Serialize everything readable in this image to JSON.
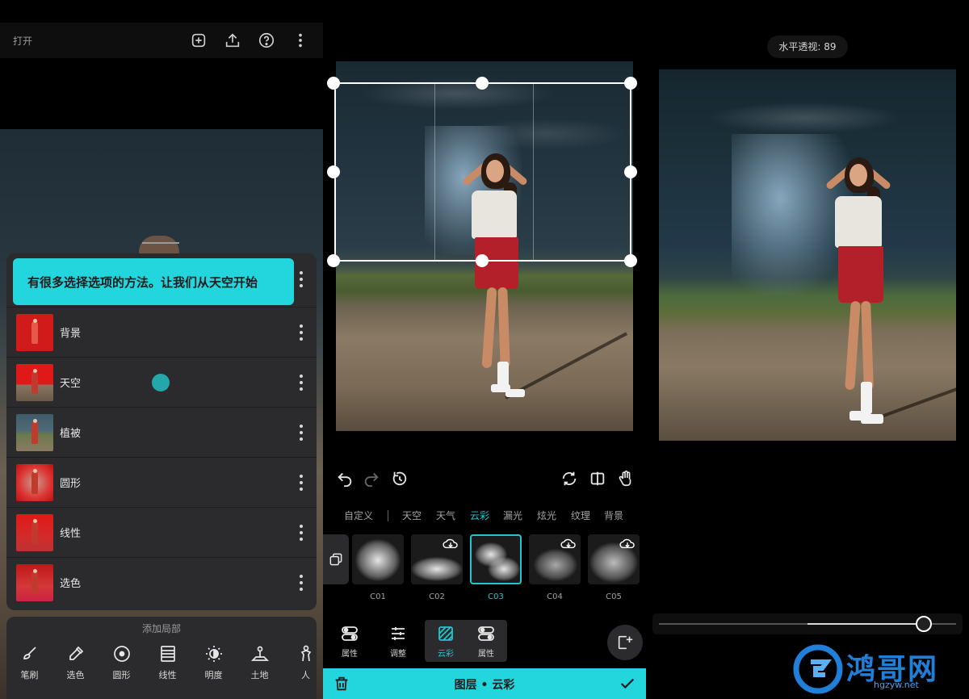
{
  "left": {
    "top": {
      "open_label": "打开"
    },
    "tip": "有很多选择选项的方法。让我们从天空开始",
    "layers": [
      {
        "label": "背景"
      },
      {
        "label": "天空"
      },
      {
        "label": "植被"
      },
      {
        "label": "圆形"
      },
      {
        "label": "线性"
      },
      {
        "label": "选色"
      }
    ],
    "add_local": {
      "title": "添加局部",
      "tools": [
        {
          "label": "笔刷",
          "icon": "brush-icon"
        },
        {
          "label": "选色",
          "icon": "eyedropper-icon"
        },
        {
          "label": "圆形",
          "icon": "circle-icon"
        },
        {
          "label": "线性",
          "icon": "linear-icon"
        },
        {
          "label": "明度",
          "icon": "brightness-icon"
        },
        {
          "label": "土地",
          "icon": "land-icon"
        },
        {
          "label": "人",
          "icon": "person-icon"
        }
      ]
    }
  },
  "middle": {
    "categories": [
      "自定义",
      "天空",
      "天气",
      "云彩",
      "漏光",
      "炫光",
      "纹理",
      "背景"
    ],
    "active_category": "云彩",
    "presets": [
      "C01",
      "C02",
      "C03",
      "C04",
      "C05"
    ],
    "active_preset": "C03",
    "tabs": [
      {
        "label": "属性",
        "icon": "toggle-icon"
      },
      {
        "label": "调整",
        "icon": "sliders-icon"
      },
      {
        "label": "云彩",
        "icon": "cloud-layer-icon"
      },
      {
        "label": "属性",
        "icon": "toggle-icon"
      }
    ],
    "bar_title": "图层 • 云彩"
  },
  "right": {
    "perspective_label": "水平透视: 89",
    "slider_value": 89
  },
  "watermark": {
    "brand": "鸿哥网",
    "url": "hgzyw.net"
  },
  "colors": {
    "accent": "#23d5dc",
    "panel": "#2b2b2d",
    "watermark": "#1f7fd9"
  }
}
